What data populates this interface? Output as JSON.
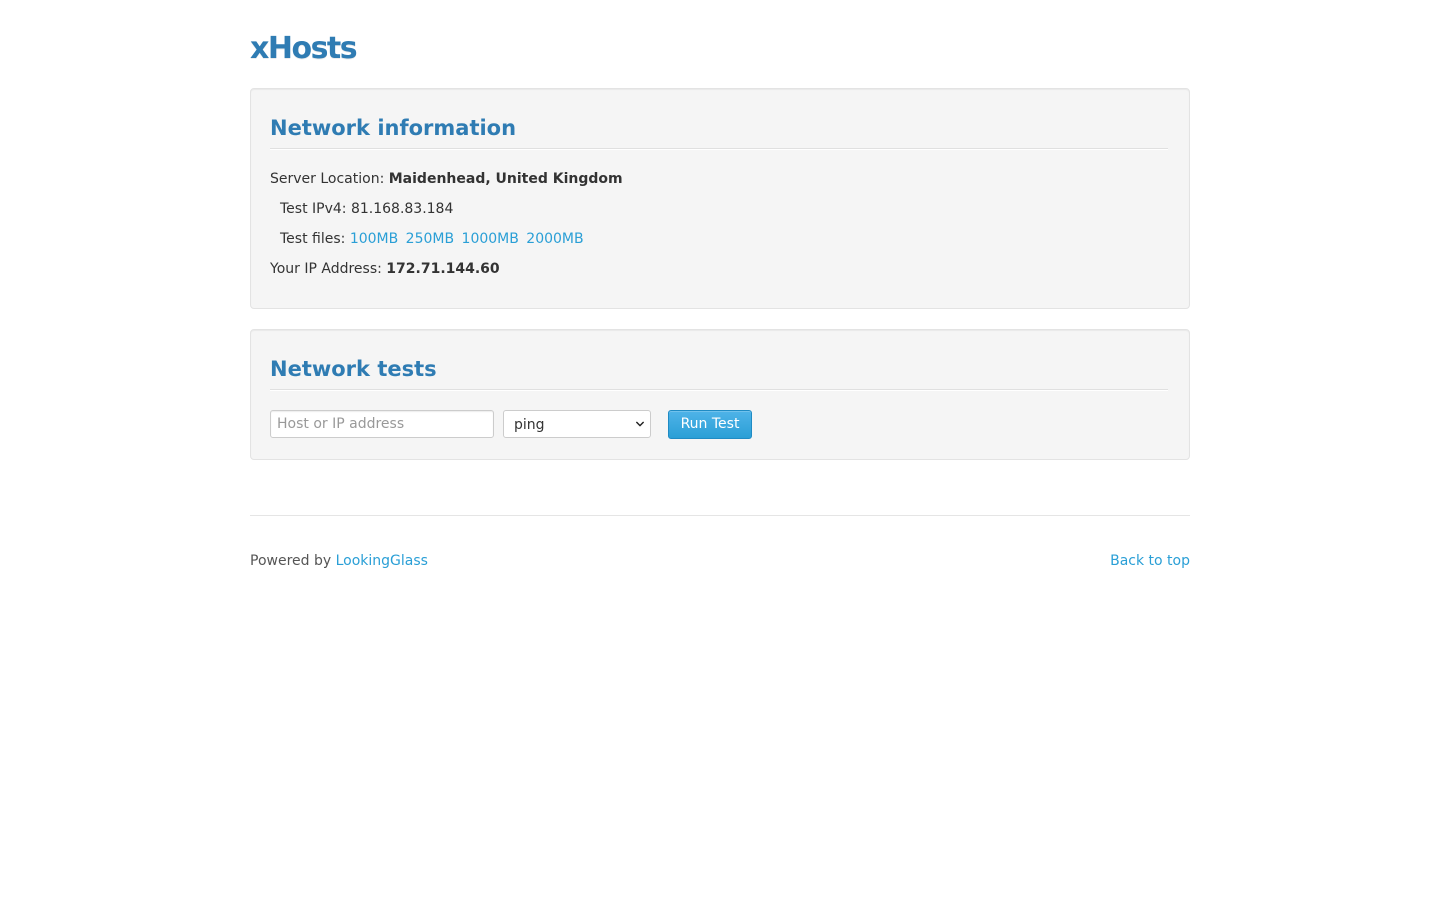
{
  "header": {
    "logo_text": "xHosts"
  },
  "network_information": {
    "title": "Network information",
    "server_location_label": "Server Location:",
    "server_location_value": "Maidenhead, United Kingdom",
    "test_ipv4_label": "Test IPv4:",
    "test_ipv4_value": "81.168.83.184",
    "test_files_label": "Test files:",
    "test_files": [
      "100MB",
      "250MB",
      "1000MB",
      "2000MB"
    ],
    "your_ip_label": "Your IP Address:",
    "your_ip_value": "172.71.144.60"
  },
  "network_tests": {
    "title": "Network tests",
    "host_input_placeholder": "Host or IP address",
    "host_input_value": "",
    "method_selected": "ping",
    "run_button_label": "Run Test"
  },
  "footer": {
    "powered_by_label": "Powered by",
    "powered_by_link": "LookingGlass",
    "back_to_top": "Back to top"
  },
  "colors": {
    "heading_blue": "#2f7cb3",
    "link_blue": "#2a9fd6",
    "button_blue": "#2a9fd6",
    "well_background": "#f5f5f5"
  },
  "icons": {
    "select_arrow": "chevron-down-icon"
  }
}
